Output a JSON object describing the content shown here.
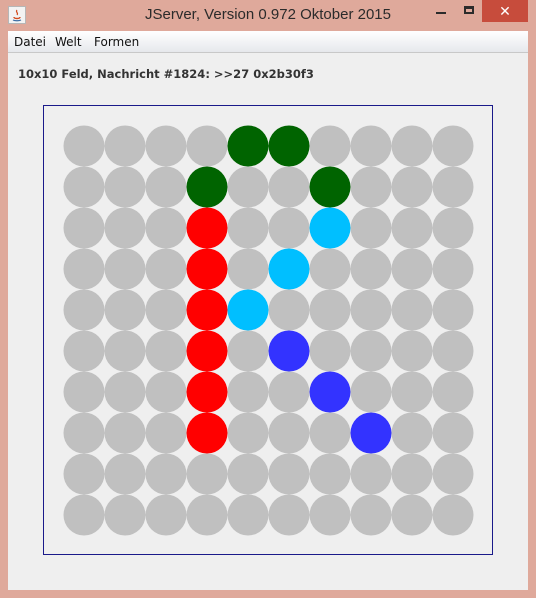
{
  "window": {
    "title": "JServer, Version 0.972 Oktober 2015",
    "close_glyph": "✕"
  },
  "menu": {
    "items": [
      "Datei",
      "Welt",
      "Formen"
    ]
  },
  "status": {
    "text": "10x10 Feld, Nachricht #1824: >>27 0x2b30f3"
  },
  "board": {
    "rows": 10,
    "cols": 10,
    "default_color": "#c0c0c0",
    "cells": [
      {
        "row": 0,
        "col": 4,
        "color": "#006400"
      },
      {
        "row": 0,
        "col": 5,
        "color": "#006400"
      },
      {
        "row": 1,
        "col": 3,
        "color": "#006400"
      },
      {
        "row": 1,
        "col": 6,
        "color": "#006400"
      },
      {
        "row": 2,
        "col": 3,
        "color": "#ff0000"
      },
      {
        "row": 2,
        "col": 6,
        "color": "#00bfff"
      },
      {
        "row": 3,
        "col": 3,
        "color": "#ff0000"
      },
      {
        "row": 3,
        "col": 5,
        "color": "#00bfff"
      },
      {
        "row": 4,
        "col": 3,
        "color": "#ff0000"
      },
      {
        "row": 4,
        "col": 4,
        "color": "#00bfff"
      },
      {
        "row": 5,
        "col": 3,
        "color": "#ff0000"
      },
      {
        "row": 5,
        "col": 5,
        "color": "#3333ff"
      },
      {
        "row": 6,
        "col": 3,
        "color": "#ff0000"
      },
      {
        "row": 6,
        "col": 6,
        "color": "#3333ff"
      },
      {
        "row": 7,
        "col": 3,
        "color": "#ff0000"
      },
      {
        "row": 7,
        "col": 7,
        "color": "#3333ff"
      }
    ]
  }
}
